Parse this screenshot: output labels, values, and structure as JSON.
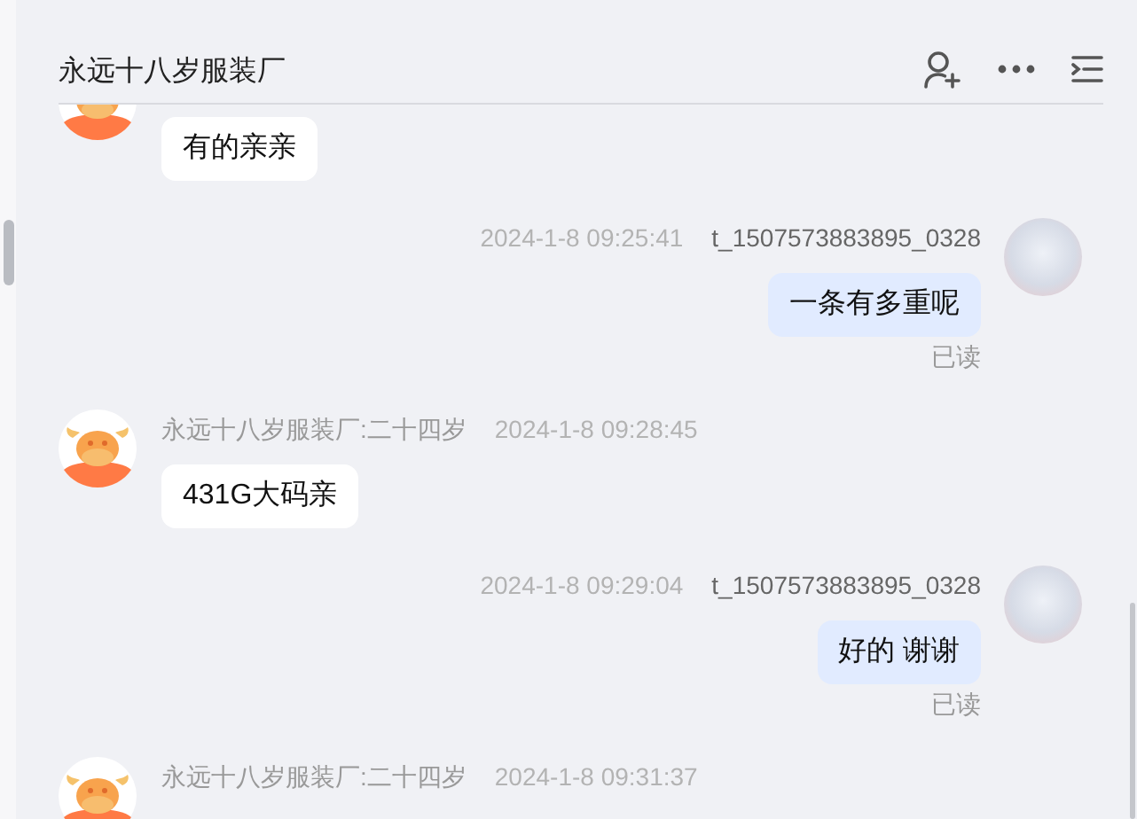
{
  "header": {
    "title": "永远十八岁服装厂"
  },
  "messages": [
    {
      "kind": "incoming",
      "text": "有的亲亲"
    },
    {
      "kind": "outgoing",
      "sender": "t_1507573883895_0328",
      "time": "2024-1-8 09:25:41",
      "text": "一条有多重呢",
      "status": "已读"
    },
    {
      "kind": "incoming",
      "sender": "永远十八岁服装厂:二十四岁",
      "time": "2024-1-8 09:28:45",
      "text": "431G大码亲"
    },
    {
      "kind": "outgoing",
      "sender": "t_1507573883895_0328",
      "time": "2024-1-8 09:29:04",
      "text": "好的 谢谢",
      "status": "已读"
    },
    {
      "kind": "incoming",
      "sender": "永远十八岁服装厂:二十四岁",
      "time": "2024-1-8 09:31:37"
    }
  ]
}
